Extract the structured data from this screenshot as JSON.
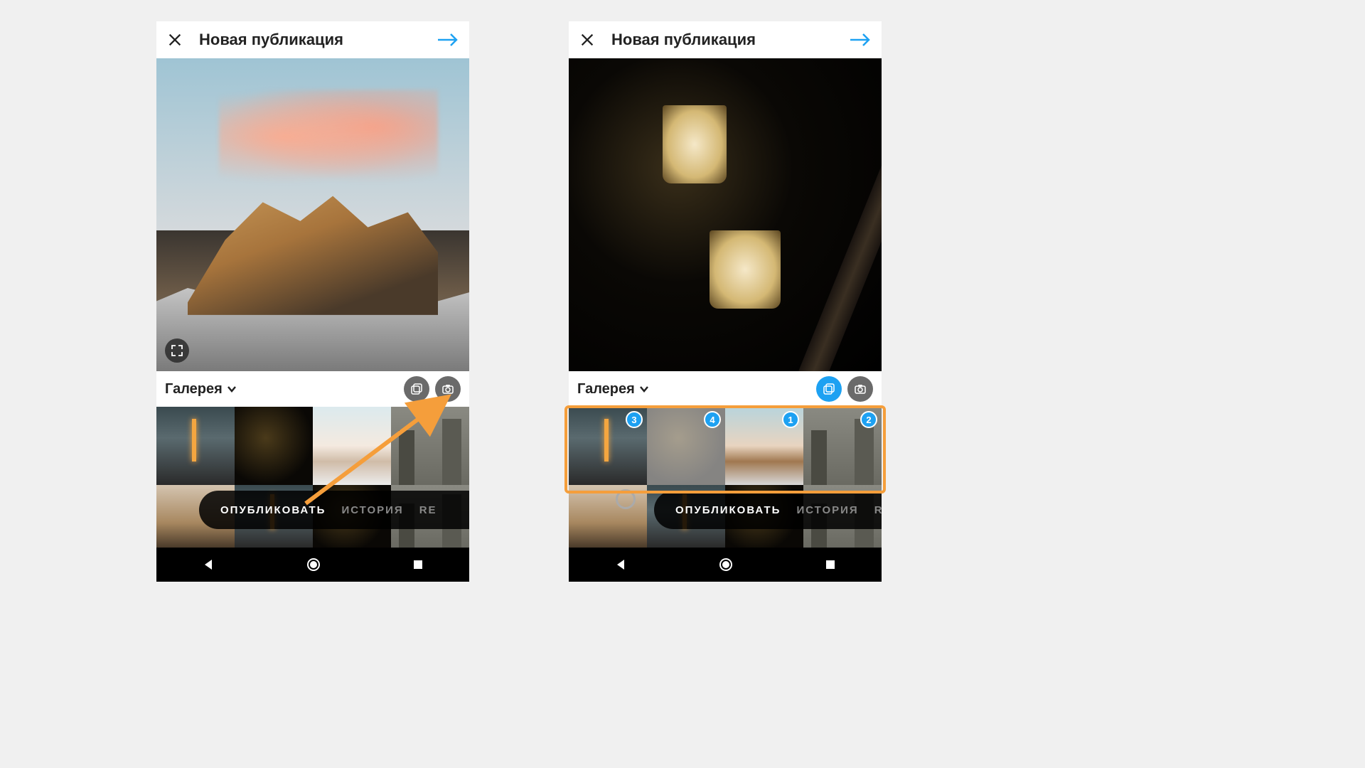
{
  "header": {
    "title": "Новая публикация"
  },
  "source": {
    "label": "Галерея"
  },
  "pill": {
    "publish": "ОПУБЛИКОВАТЬ",
    "story": "ИСТОРИЯ",
    "reels": "RE"
  },
  "right": {
    "badges": [
      "3",
      "4",
      "1",
      "2"
    ]
  },
  "colors": {
    "accent": "#1da1f2",
    "highlight": "#f59e3b"
  }
}
